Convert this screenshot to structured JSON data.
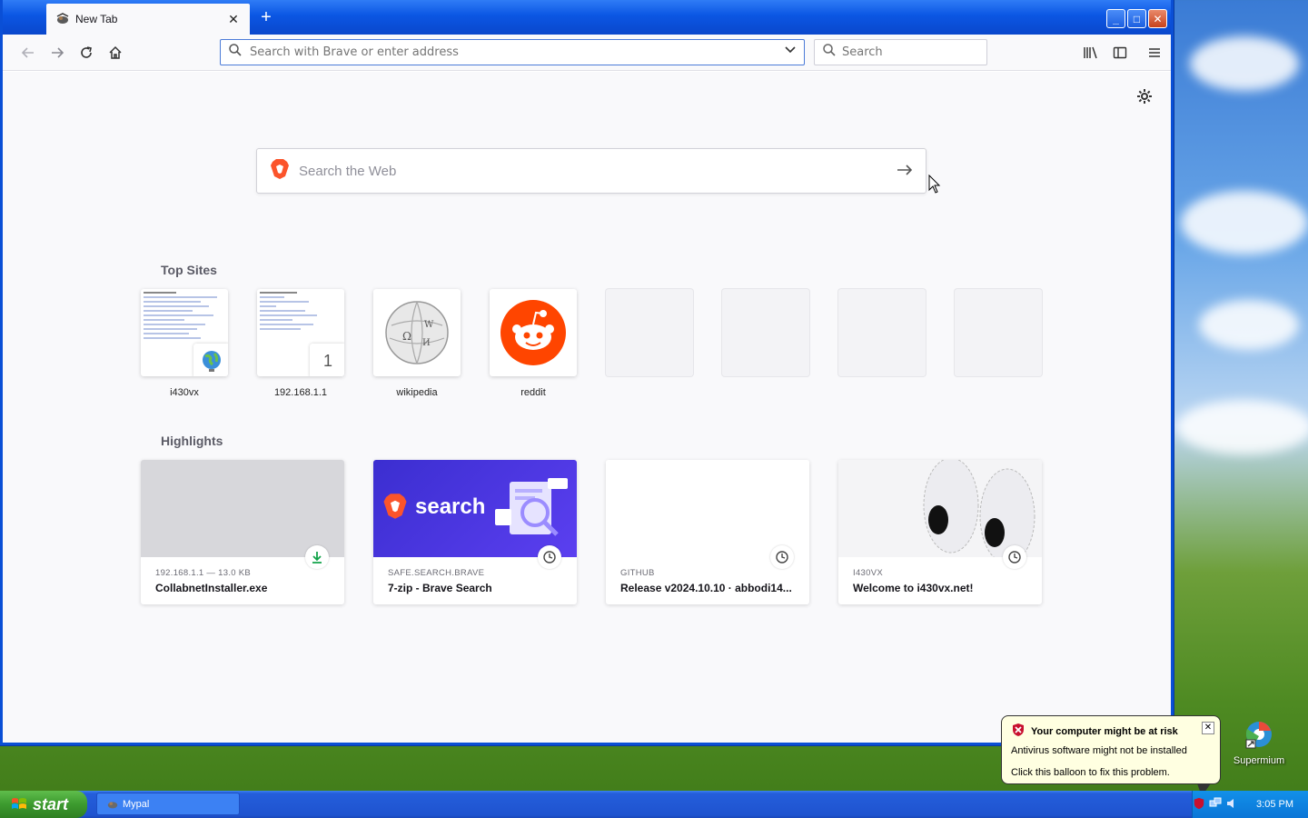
{
  "browser": {
    "tab_title": "New Tab",
    "url_placeholder": "Search with Brave or enter address",
    "search_placeholder": "Search"
  },
  "newtab": {
    "websearch_placeholder": "Search the Web",
    "top_sites_heading": "Top Sites",
    "top_sites": [
      {
        "label": "i430vx"
      },
      {
        "label": "192.168.1.1",
        "badge": "1"
      },
      {
        "label": "wikipedia"
      },
      {
        "label": "reddit"
      },
      {
        "label": ""
      },
      {
        "label": ""
      },
      {
        "label": ""
      },
      {
        "label": ""
      }
    ],
    "highlights_heading": "Highlights",
    "highlights": [
      {
        "source": "192.168.1.1 — 13.0 KB",
        "title": "CollabnetInstaller.exe",
        "icon": "download-icon"
      },
      {
        "source": "SAFE.SEARCH.BRAVE",
        "title": "7-zip - Brave Search",
        "icon": "clock-icon",
        "image_text": "search"
      },
      {
        "source": "GITHUB",
        "title": "Release v2024.10.10 · abbodi14...",
        "icon": "clock-icon"
      },
      {
        "source": "I430VX",
        "title": "Welcome to i430vx.net!",
        "icon": "clock-icon"
      }
    ]
  },
  "taskbar": {
    "start_label": "start",
    "task_label": "Mypal",
    "clock": "3:05 PM"
  },
  "balloon": {
    "title": "Your computer might be at risk",
    "line1": "Antivirus software might not be installed",
    "line2": "Click this balloon to fix this problem."
  },
  "desktop": {
    "icon_label": "Supermium"
  },
  "colors": {
    "xp_blue": "#0b56e3",
    "brave_orange": "#fb542b",
    "reddit_orange": "#ff4500",
    "search_purple": "#3b2ed0"
  }
}
